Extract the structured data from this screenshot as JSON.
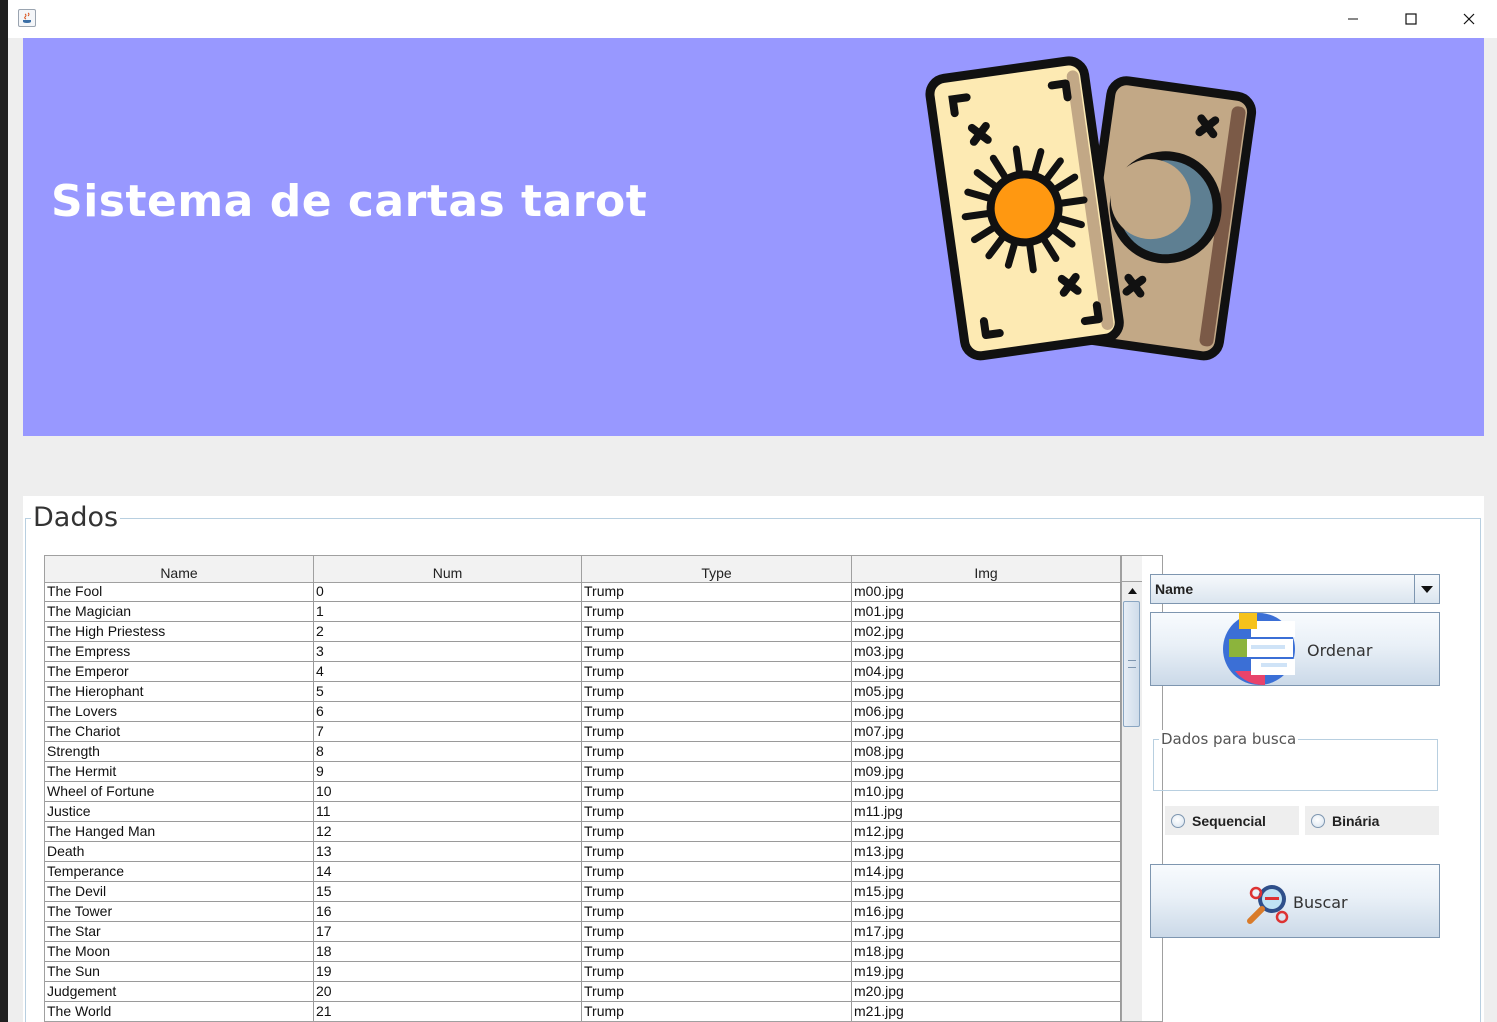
{
  "window": {
    "title": ""
  },
  "banner": {
    "title": "Sistema de cartas tarot"
  },
  "panel": {
    "legend": "Dados"
  },
  "table": {
    "columns": [
      "Name",
      "Num",
      "Type",
      "Img"
    ],
    "rows": [
      [
        "The Fool",
        "0",
        "Trump",
        "m00.jpg"
      ],
      [
        "The Magician",
        "1",
        "Trump",
        "m01.jpg"
      ],
      [
        "The High Priestess",
        "2",
        "Trump",
        "m02.jpg"
      ],
      [
        "The Empress",
        "3",
        "Trump",
        "m03.jpg"
      ],
      [
        "The Emperor",
        "4",
        "Trump",
        "m04.jpg"
      ],
      [
        "The Hierophant",
        "5",
        "Trump",
        "m05.jpg"
      ],
      [
        "The Lovers",
        "6",
        "Trump",
        "m06.jpg"
      ],
      [
        "The Chariot",
        "7",
        "Trump",
        "m07.jpg"
      ],
      [
        "Strength",
        "8",
        "Trump",
        "m08.jpg"
      ],
      [
        "The Hermit",
        "9",
        "Trump",
        "m09.jpg"
      ],
      [
        "Wheel of Fortune",
        "10",
        "Trump",
        "m10.jpg"
      ],
      [
        "Justice",
        "11",
        "Trump",
        "m11.jpg"
      ],
      [
        "The Hanged Man",
        "12",
        "Trump",
        "m12.jpg"
      ],
      [
        "Death",
        "13",
        "Trump",
        "m13.jpg"
      ],
      [
        "Temperance",
        "14",
        "Trump",
        "m14.jpg"
      ],
      [
        "The Devil",
        "15",
        "Trump",
        "m15.jpg"
      ],
      [
        "The Tower",
        "16",
        "Trump",
        "m16.jpg"
      ],
      [
        "The Star",
        "17",
        "Trump",
        "m17.jpg"
      ],
      [
        "The Moon",
        "18",
        "Trump",
        "m18.jpg"
      ],
      [
        "The Sun",
        "19",
        "Trump",
        "m19.jpg"
      ],
      [
        "Judgement",
        "20",
        "Trump",
        "m20.jpg"
      ],
      [
        "The World",
        "21",
        "Trump",
        "m21.jpg"
      ]
    ]
  },
  "controls": {
    "sort_field": "Name",
    "order_label": "Ordenar",
    "search_legend": "Dados para busca",
    "search_value": "",
    "radio_sequential": "Sequencial",
    "radio_binary": "Binária",
    "search_label": "Buscar"
  },
  "colors": {
    "banner_bg": "#9898ff",
    "card_front": "#fdeab3",
    "card_back": "#c2a886",
    "sun": "#ff9811",
    "moon": "#5e7f92"
  }
}
